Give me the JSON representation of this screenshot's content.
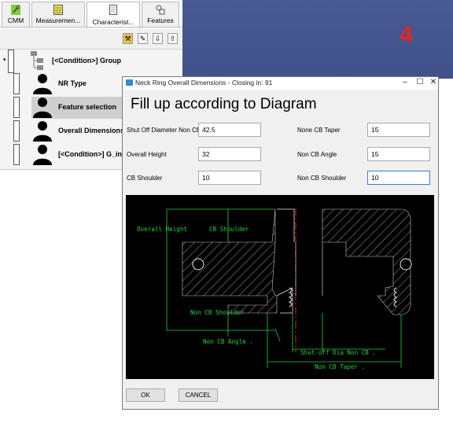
{
  "step_number": "4",
  "tabs": [
    {
      "label": "CMM",
      "icon": "wrench-icon"
    },
    {
      "label": "Measuremen...",
      "icon": "table-icon"
    },
    {
      "label": "Characterist...",
      "icon": "document-icon"
    },
    {
      "label": "Features",
      "icon": "shapes-icon"
    }
  ],
  "toolbar": {
    "icons": [
      "tools-icon",
      "pencil-icon",
      "arrow-down-icon",
      "arrow-up-icon"
    ]
  },
  "tree": {
    "group_label": "[<Condition>] Group",
    "items": [
      {
        "label": "NR Type"
      },
      {
        "label": "Feature selection"
      },
      {
        "label": "Overall Dimensions"
      },
      {
        "label": "[<Condition>] G_info"
      }
    ]
  },
  "dialog": {
    "title": "Neck Ring Overall Dimensions - Closing in: 91",
    "heading": "Fill up according to Diagram",
    "fields": [
      {
        "label": "Shut Off Diameter Non CB",
        "value": "42.5"
      },
      {
        "label": "Overall Height",
        "value": "32"
      },
      {
        "label": "CB Shoulder",
        "value": "10"
      },
      {
        "label": "None CB Taper",
        "value": "15"
      },
      {
        "label": "Non CB Angle",
        "value": "15"
      },
      {
        "label": "Non CB Shoulder",
        "value": "10"
      }
    ],
    "diagram_labels": {
      "overall_height": "Overall Height",
      "cb_shoulder": "CB Shoulder",
      "non_cb_shoulder": "Non CB Shoulder",
      "non_cb_angle": "Non CB Angle .",
      "shutoff_dia": "Shut-off Dia Non CB .",
      "non_cb_taper": "Non CB Taper ."
    },
    "ok_label": "OK",
    "cancel_label": "CANCEL"
  }
}
